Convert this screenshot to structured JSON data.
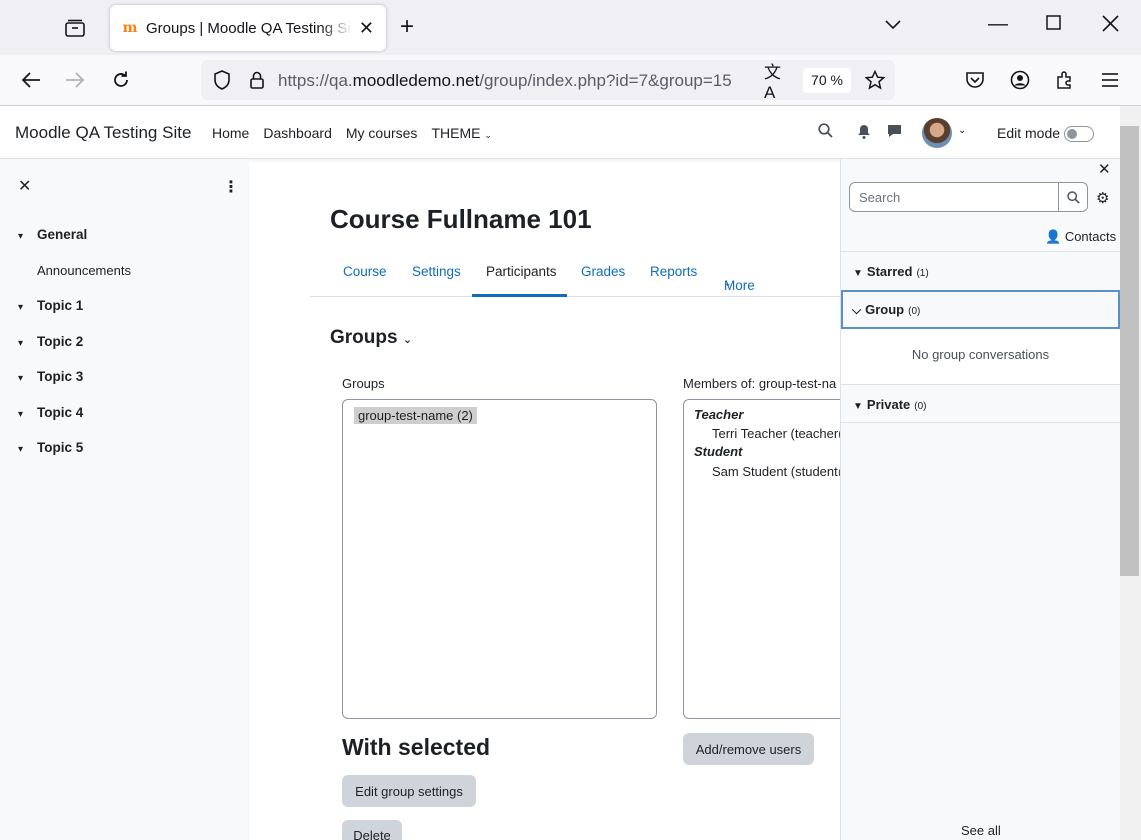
{
  "browser": {
    "tab_title": "Groups | Moodle QA Testing Site",
    "url_prefix": "https://qa.",
    "url_domain": "moodledemo.net",
    "url_path": "/group/index.php?id=7&group=15",
    "zoom": "70 %"
  },
  "header": {
    "site_name": "Moodle QA Testing Site",
    "nav": [
      "Home",
      "Dashboard",
      "My courses",
      "THEME"
    ],
    "edit_mode_label": "Edit mode",
    "edit_mode_on": false
  },
  "course_index": {
    "sections": [
      {
        "label": "General",
        "items": [
          "Announcements"
        ]
      },
      {
        "label": "Topic 1"
      },
      {
        "label": "Topic 2"
      },
      {
        "label": "Topic 3"
      },
      {
        "label": "Topic 4"
      },
      {
        "label": "Topic 5"
      }
    ]
  },
  "main": {
    "course_title": "Course Fullname 101",
    "tabs": [
      "Course",
      "Settings",
      "Participants",
      "Grades",
      "Reports",
      "More"
    ],
    "active_tab": "Participants",
    "page_heading": "Groups",
    "groups_label": "Groups",
    "groups": [
      "group-test-name (2)"
    ],
    "members_label": "Members of: group-test-na",
    "members": [
      {
        "role": "Teacher",
        "name": "Terri Teacher (teacher("
      },
      {
        "role": "Student",
        "name": "Sam Student (student@"
      }
    ],
    "with_selected": "With selected",
    "edit_group_settings": "Edit group settings",
    "delete": "Delete",
    "add_remove_users": "Add/remove users"
  },
  "messages": {
    "search_placeholder": "Search",
    "contacts": "Contacts",
    "starred": {
      "label": "Starred",
      "count": "(1)"
    },
    "group": {
      "label": "Group",
      "count": "(0)",
      "empty": "No group conversations"
    },
    "private": {
      "label": "Private",
      "count": "(0)"
    },
    "see_all": "See all"
  }
}
